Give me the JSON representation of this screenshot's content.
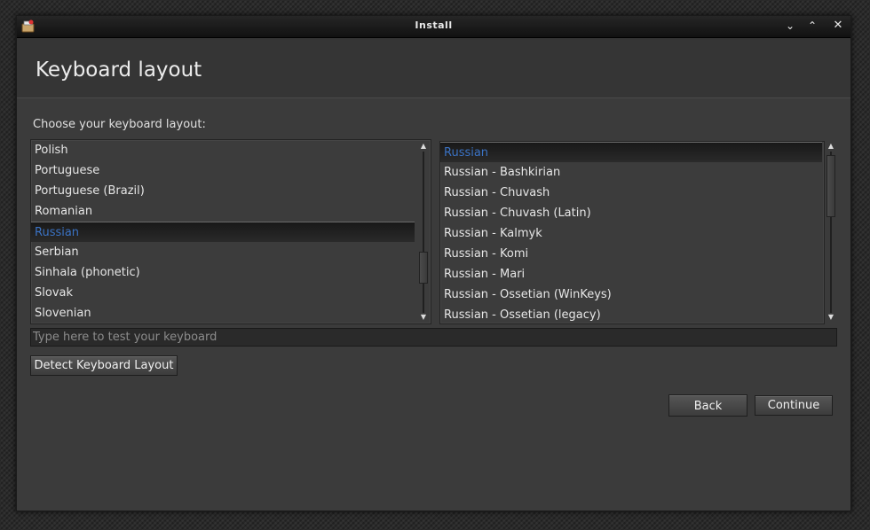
{
  "window": {
    "title": "Install",
    "minimize_glyph": "⌄",
    "maximize_glyph": "⌃",
    "close_glyph": "✕"
  },
  "page": {
    "title": "Keyboard layout"
  },
  "prompt": "Choose your keyboard layout:",
  "layouts": {
    "items": [
      "Polish",
      "Portuguese",
      "Portuguese (Brazil)",
      "Romanian",
      "Russian",
      "Serbian",
      "Sinhala (phonetic)",
      "Slovak",
      "Slovenian"
    ],
    "selected": "Russian"
  },
  "variants": {
    "items": [
      "Russian",
      "Russian - Bashkirian",
      "Russian - Chuvash",
      "Russian - Chuvash (Latin)",
      "Russian - Kalmyk",
      "Russian - Komi",
      "Russian - Mari",
      "Russian - Ossetian (WinKeys)",
      "Russian - Ossetian (legacy)"
    ],
    "selected": "Russian"
  },
  "test_field": {
    "value": "",
    "placeholder": "Type here to test your keyboard"
  },
  "buttons": {
    "detect": "Detect Keyboard Layout",
    "back": "Back",
    "continue": "Continue"
  }
}
